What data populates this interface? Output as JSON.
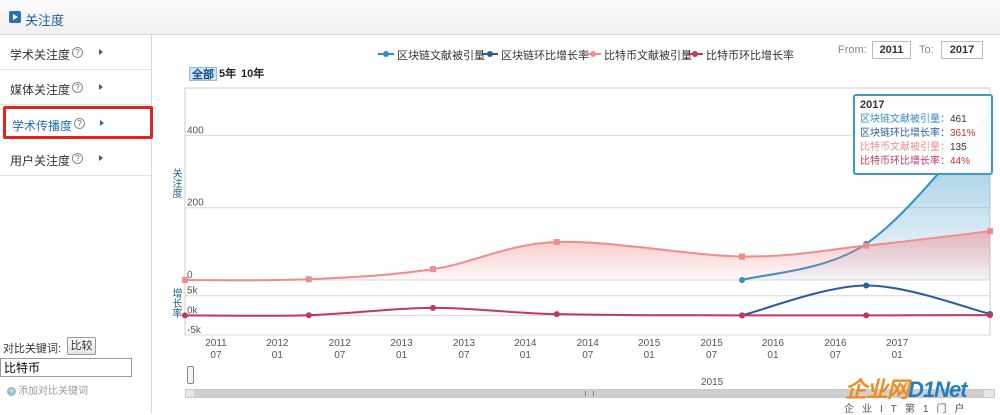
{
  "header": {
    "title": "关注度"
  },
  "sidebar": {
    "items": [
      {
        "label": "学术关注度"
      },
      {
        "label": "媒体关注度"
      },
      {
        "label": "学术传播度"
      },
      {
        "label": "用户关注度"
      }
    ],
    "help_glyph": "?",
    "compare_label": "对比关键词:",
    "compare_button": "比较",
    "compare_value": "比特币",
    "add_keyword": "添加对比关键词"
  },
  "controls": {
    "zoom": [
      "全部",
      "5年",
      "10年"
    ],
    "from_label": "From:",
    "from_value": "2011",
    "to_label": "To:",
    "to_value": "2017"
  },
  "tooltip": {
    "year": "2017",
    "rows": [
      {
        "label": "区块链文献被引量：",
        "value": "461",
        "color": "#2e8fc6"
      },
      {
        "label": "区块链环比增长率：",
        "value": "361%",
        "color": "#2a5d9f"
      },
      {
        "label": "比特币文献被引量：",
        "value": "135",
        "color": "#f08c8c"
      },
      {
        "label": "比特币环比增长率：",
        "value": "44%",
        "color": "#c2375f"
      }
    ]
  },
  "navigator": {
    "label": "2015"
  },
  "watermark": {
    "text_orange": "企业网",
    "text_blue": "D1Net",
    "sub": "企业IT第1门户"
  },
  "chart_data": {
    "type": "line",
    "x_dates": [
      "2011-01-01",
      "2011-07-01",
      "2012-07-01",
      "2013-07-01",
      "2014-07-01",
      "2015-07-01",
      "2016-07-01",
      "2017-07-01"
    ],
    "x_ticks": [
      {
        "t": "2011-01-01",
        "label": "2011\n07"
      },
      {
        "t": "2011-07-01",
        "label": "2012\n01"
      },
      {
        "t": "2012-01-01",
        "label": "2012\n07"
      },
      {
        "t": "2012-07-01",
        "label": "2013\n01"
      },
      {
        "t": "2013-01-01",
        "label": "2013\n07"
      },
      {
        "t": "2013-07-01",
        "label": "2014\n01"
      },
      {
        "t": "2014-01-01",
        "label": "2014\n07"
      },
      {
        "t": "2014-07-01",
        "label": "2015\n01"
      },
      {
        "t": "2015-01-01",
        "label": "2015\n07"
      },
      {
        "t": "2015-07-01",
        "label": "2016\n01"
      },
      {
        "t": "2016-01-01",
        "label": "2016\n07"
      },
      {
        "t": "2016-07-01",
        "label": "2017\n01"
      }
    ],
    "panels": [
      {
        "ylabel": "关注度",
        "yticks": [
          "0",
          "200",
          "400"
        ],
        "ylim": [
          0,
          520
        ],
        "series": [
          {
            "name": "区块链文献被引量",
            "color": "#2e8fc6",
            "area": true,
            "points": [
              [
                "2015-07-01",
                0
              ],
              [
                "2016-07-01",
                100
              ],
              [
                "2017-07-01",
                461
              ]
            ]
          },
          {
            "name": "比特币文献被引量",
            "color": "#f08c8c",
            "area": true,
            "points": [
              [
                "2011-01-01",
                0
              ],
              [
                "2012-01-01",
                2
              ],
              [
                "2013-01-01",
                30
              ],
              [
                "2014-01-01",
                105
              ],
              [
                "2015-07-01",
                65
              ],
              [
                "2016-07-01",
                95
              ],
              [
                "2017-07-01",
                135
              ]
            ]
          }
        ]
      },
      {
        "ylabel": "增长率",
        "yticks": [
          "-5k",
          "0k",
          "5k"
        ],
        "ylim": [
          -5000,
          9000
        ],
        "series": [
          {
            "name": "区块链环比增长率",
            "color": "#2a5d9f",
            "points": [
              [
                "2015-07-01",
                0
              ],
              [
                "2016-07-01",
                7600
              ],
              [
                "2017-07-01",
                361
              ]
            ]
          },
          {
            "name": "比特币环比增长率",
            "color": "#c2375f",
            "points": [
              [
                "2011-01-01",
                0
              ],
              [
                "2012-01-01",
                40
              ],
              [
                "2013-01-01",
                1900
              ],
              [
                "2014-01-01",
                300
              ],
              [
                "2015-07-01",
                0
              ],
              [
                "2016-07-01",
                0
              ],
              [
                "2017-07-01",
                44
              ]
            ]
          }
        ]
      }
    ]
  }
}
